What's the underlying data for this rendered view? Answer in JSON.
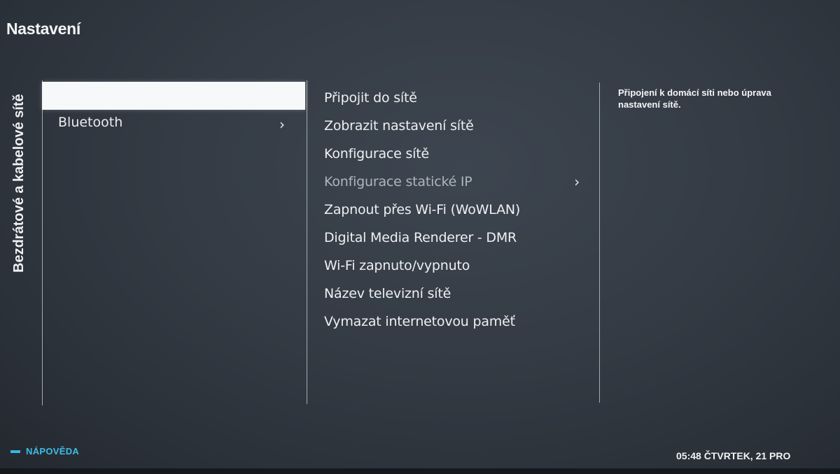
{
  "header": {
    "title": "Nastavení"
  },
  "category": {
    "vertical_title": "Bezdrátové a kabelové sítě"
  },
  "menu_level1": {
    "items": [
      {
        "label": "",
        "selected": true
      },
      {
        "label": "Bluetooth",
        "has_submenu": true,
        "chevron": "›"
      }
    ]
  },
  "menu_level2": {
    "items": [
      {
        "label": "Připojit do sítě"
      },
      {
        "label": "Zobrazit nastavení sítě"
      },
      {
        "label": "Konfigurace sítě"
      },
      {
        "label": "Konfigurace statické IP",
        "dimmed": true,
        "chevron": "›"
      },
      {
        "label": "Zapnout přes Wi-Fi (WoWLAN)"
      },
      {
        "label": "Digital Media Renderer - DMR"
      },
      {
        "label": "Wi-Fi zapnuto/vypnuto"
      },
      {
        "label": "Název televizní sítě"
      },
      {
        "label": "Vymazat internetovou paměť"
      }
    ]
  },
  "description": {
    "text": "Připojení k domácí síti nebo úprava nastavení sítě."
  },
  "footer": {
    "help_label": "NÁPOVĚDA",
    "help_color": "#38b6e0",
    "clock": "05:48 ČTVRTEK, 21 PRO"
  },
  "icons": {
    "chevron": "chevron-right-icon",
    "help_marker": "color-key-bar-icon"
  }
}
